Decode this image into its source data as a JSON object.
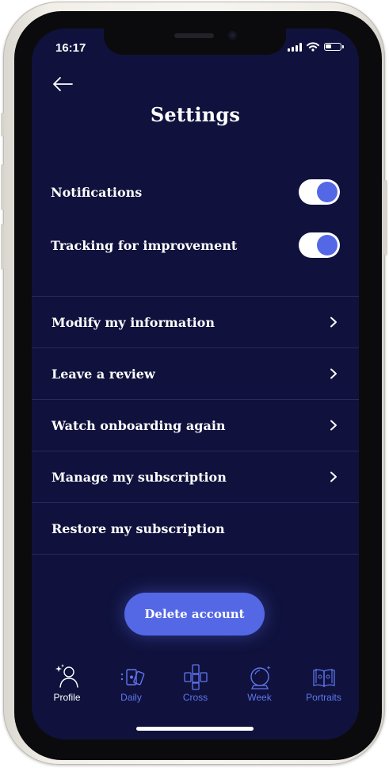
{
  "status_bar": {
    "time": "16:17"
  },
  "header": {
    "title": "Settings"
  },
  "toggles": [
    {
      "label": "Notifications",
      "enabled": true
    },
    {
      "label": "Tracking for improvement",
      "enabled": true
    }
  ],
  "menu": [
    {
      "label": "Modify my information",
      "chevron": true
    },
    {
      "label": "Leave a review",
      "chevron": true
    },
    {
      "label": "Watch onboarding again",
      "chevron": true
    },
    {
      "label": "Manage my subscription",
      "chevron": true
    },
    {
      "label": "Restore my subscription",
      "chevron": false
    }
  ],
  "delete_button": {
    "label": "Delete account"
  },
  "tabbar": [
    {
      "label": "Profile",
      "icon": "profile-icon",
      "active": true
    },
    {
      "label": "Daily",
      "icon": "daily-cards-icon",
      "active": false
    },
    {
      "label": "Cross",
      "icon": "cross-cards-icon",
      "active": false
    },
    {
      "label": "Week",
      "icon": "crystal-ball-icon",
      "active": false
    },
    {
      "label": "Portraits",
      "icon": "book-icon",
      "active": false
    }
  ],
  "colors": {
    "background": "#10123d",
    "accent": "#5468e6",
    "tab_inactive": "#5f76ef"
  }
}
